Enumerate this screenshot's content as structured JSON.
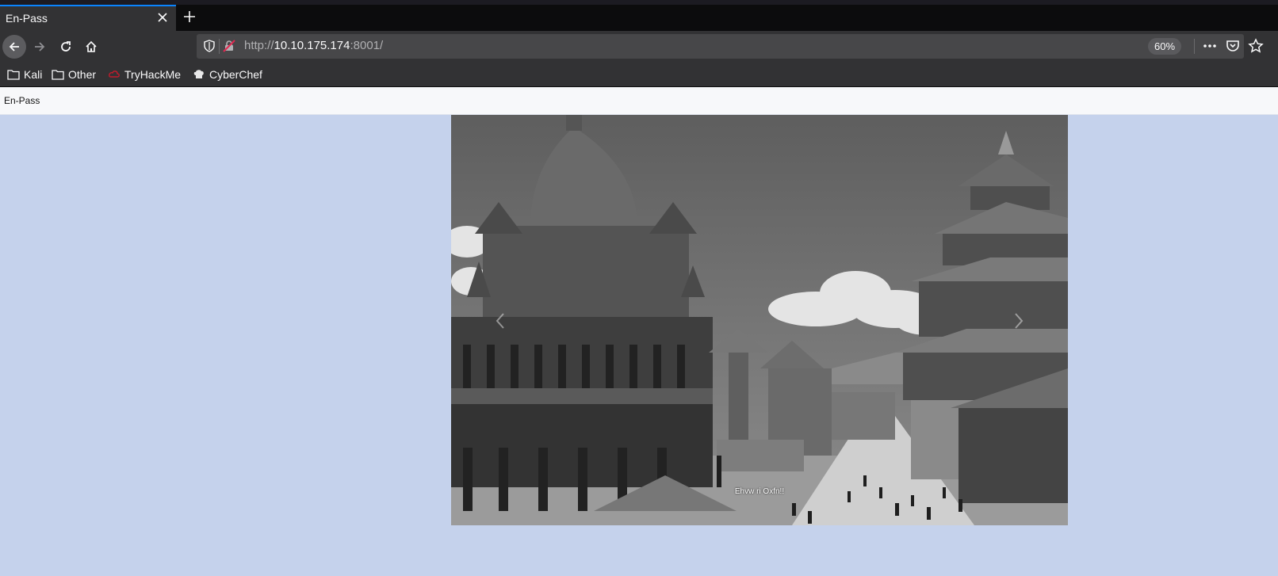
{
  "browser": {
    "tab_title": "En-Pass",
    "url_scheme": "http://",
    "url_host": "10.10.175.174",
    "url_port_path": ":8001/",
    "zoom": "60%",
    "bookmarks": [
      {
        "label": "Kali",
        "icon": "folder-icon"
      },
      {
        "label": "Other",
        "icon": "folder-icon"
      },
      {
        "label": "TryHackMe",
        "icon": "tryhackme-icon"
      },
      {
        "label": "CyberChef",
        "icon": "cyberchef-icon"
      }
    ]
  },
  "page": {
    "brand": "En-Pass",
    "carousel": {
      "caption": "Ehvw ri Oxfn!!"
    }
  }
}
